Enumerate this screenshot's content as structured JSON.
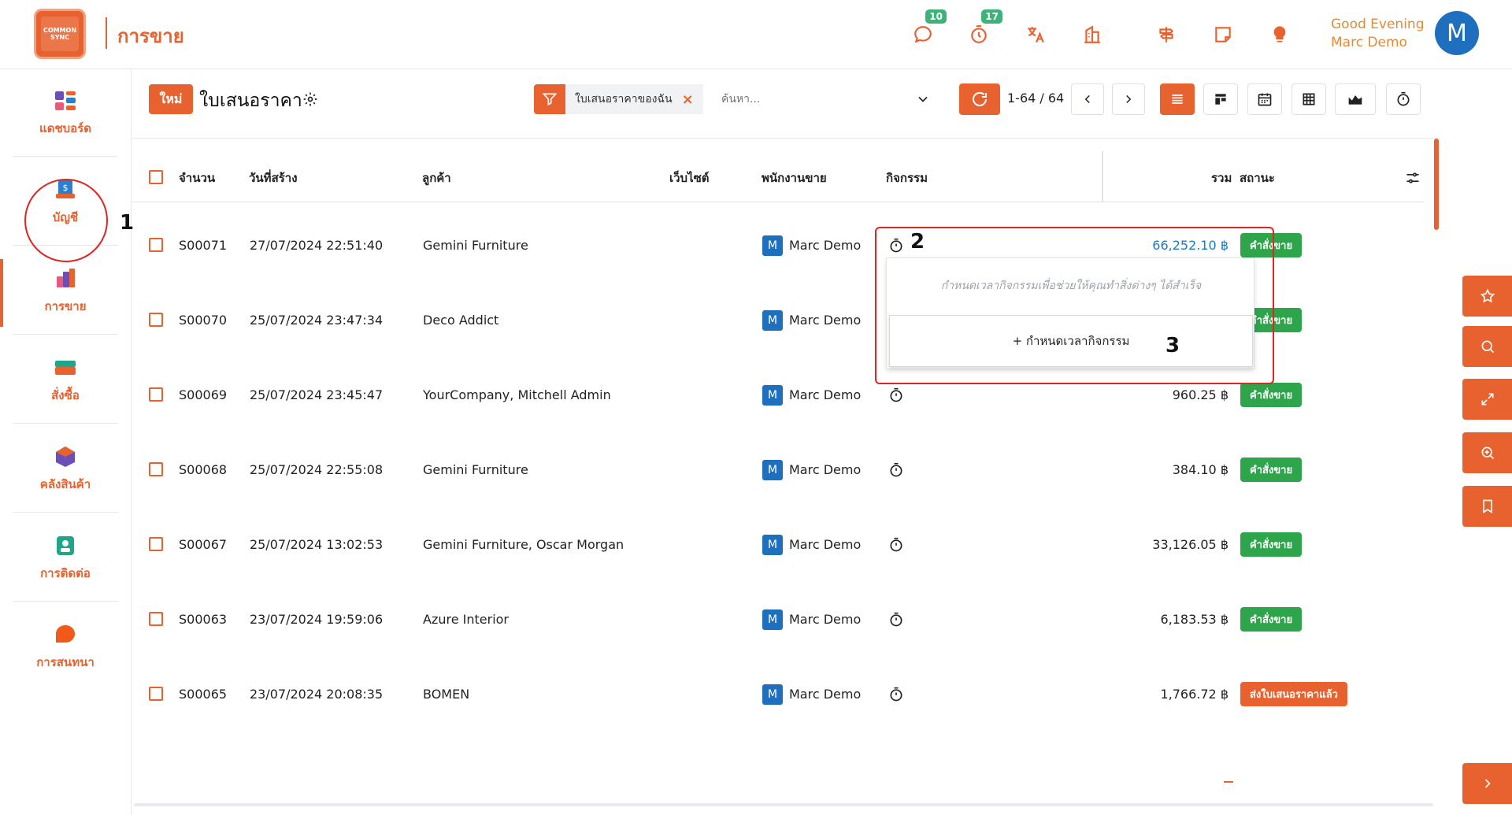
{
  "app": {
    "logo_text": "COMMON SYNC",
    "module_title": "การขาย",
    "greeting": "Good Evening",
    "user_name": "Marc Demo",
    "avatar_letter": "M",
    "accent_color": "#e8622f"
  },
  "topbar_icons": [
    {
      "name": "chat-icon",
      "badge": "10"
    },
    {
      "name": "timer-icon",
      "badge": "17"
    },
    {
      "name": "translate-icon",
      "badge": ""
    },
    {
      "name": "company-icon",
      "badge": ""
    },
    {
      "name": "signpost-icon",
      "badge": ""
    },
    {
      "name": "note-icon",
      "badge": ""
    },
    {
      "name": "tip-icon",
      "badge": ""
    }
  ],
  "sidebar": {
    "items": [
      {
        "label": "แดชบอร์ด",
        "icon": "dashboard-icon"
      },
      {
        "label": "บัญชี",
        "icon": "accounting-icon"
      },
      {
        "label": "การขาย",
        "icon": "sales-icon",
        "active": true
      },
      {
        "label": "สั่งซื้อ",
        "icon": "purchase-icon"
      },
      {
        "label": "คลังสินค้า",
        "icon": "inventory-icon"
      },
      {
        "label": "การติดต่อ",
        "icon": "contacts-icon"
      },
      {
        "label": "การสนทนา",
        "icon": "discuss-icon"
      }
    ]
  },
  "control": {
    "new_label": "ใหม่",
    "title": "ใบเสนอราคา",
    "facet_label": "ใบเสนอราคาของฉัน",
    "search_placeholder": "ค้นหา...",
    "pager_value": "1-64 / 64"
  },
  "table": {
    "headers": {
      "number": "จำนวน",
      "date": "วันที่สร้าง",
      "customer": "ลูกค้า",
      "website": "เว็บไซต์",
      "salesperson": "พนักงานขาย",
      "activity": "กิจกรรม",
      "total": "รวม",
      "status": "สถานะ"
    },
    "rows": [
      {
        "number": "S00071",
        "date": "27/07/2024 22:51:40",
        "customer": "Gemini Furniture",
        "salesperson": "Marc Demo",
        "sp_initial": "M",
        "total": "66,252.10 ฿",
        "status": "คำสั่งขาย",
        "status_kind": "order"
      },
      {
        "number": "S00070",
        "date": "25/07/2024 23:47:34",
        "customer": "Deco Addict",
        "salesperson": "Marc Demo",
        "sp_initial": "M",
        "total": "",
        "status": "คำสั่งขาย",
        "status_kind": "order"
      },
      {
        "number": "S00069",
        "date": "25/07/2024 23:45:47",
        "customer": "YourCompany, Mitchell Admin",
        "salesperson": "Marc Demo",
        "sp_initial": "M",
        "total": "960.25 ฿",
        "status": "คำสั่งขาย",
        "status_kind": "order"
      },
      {
        "number": "S00068",
        "date": "25/07/2024 22:55:08",
        "customer": "Gemini Furniture",
        "salesperson": "Marc Demo",
        "sp_initial": "M",
        "total": "384.10 ฿",
        "status": "คำสั่งขาย",
        "status_kind": "order"
      },
      {
        "number": "S00067",
        "date": "25/07/2024 13:02:53",
        "customer": "Gemini Furniture, Oscar Morgan",
        "salesperson": "Marc Demo",
        "sp_initial": "M",
        "total": "33,126.05 ฿",
        "status": "คำสั่งขาย",
        "status_kind": "order"
      },
      {
        "number": "S00063",
        "date": "23/07/2024 19:59:06",
        "customer": "Azure Interior",
        "salesperson": "Marc Demo",
        "sp_initial": "M",
        "total": "6,183.53 ฿",
        "status": "คำสั่งขาย",
        "status_kind": "order"
      },
      {
        "number": "S00065",
        "date": "23/07/2024 20:08:35",
        "customer": "BOMEN",
        "salesperson": "Marc Demo",
        "sp_initial": "M",
        "total": "1,766.72 ฿",
        "status": "ส่งใบเสนอราคาแล้ว",
        "status_kind": "sent"
      }
    ]
  },
  "activity_popover": {
    "message": "กำหนดเวลากิจกรรมเพื่อช่วยให้คุณทำสิ่งต่างๆ ได้สำเร็จ",
    "schedule_label": "+ กำหนดเวลากิจกรรม"
  },
  "annotations": {
    "one": "1",
    "two": "2",
    "three": "3"
  },
  "right_tools": [
    "star-icon",
    "search-icon",
    "expand-icon",
    "zoom-icon",
    "bookmark-icon"
  ]
}
